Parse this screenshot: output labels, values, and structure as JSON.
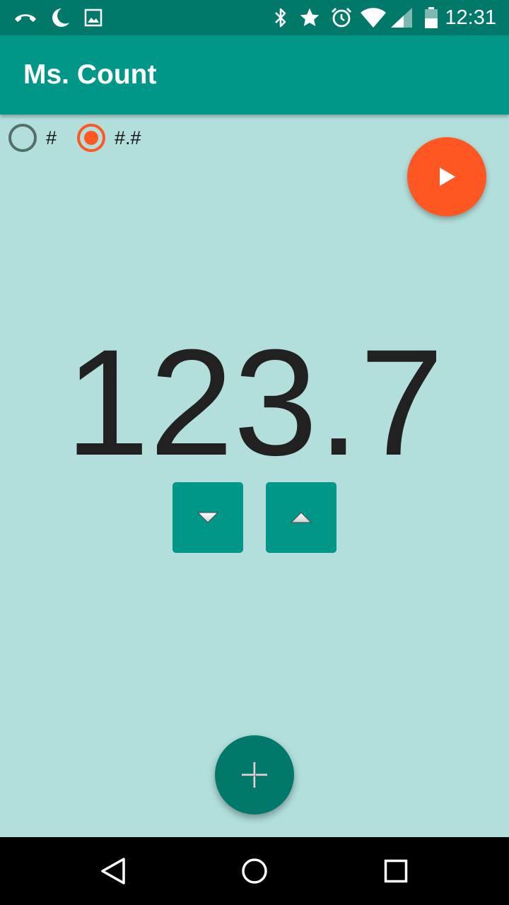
{
  "status_bar": {
    "time": "12:31",
    "icons_left": [
      "phone-hangup-icon",
      "do-not-disturb-moon-icon",
      "image-notification-icon"
    ],
    "icons_right": [
      "bluetooth-icon",
      "star-icon",
      "alarm-icon",
      "wifi-icon",
      "signal-icon",
      "battery-icon"
    ],
    "background": "#00796b"
  },
  "app_bar": {
    "title": "Ms. Count",
    "background": "#009688"
  },
  "format_options": {
    "integer_label": "#",
    "decimal_label": "#.#",
    "selected": "#.#"
  },
  "counter": {
    "value": "123.7"
  },
  "controls": {
    "play_icon": "play-icon",
    "decrement_icon": "triangle-down-icon",
    "increment_icon": "triangle-up-icon",
    "add_icon": "plus-icon"
  },
  "nav_bar": {
    "icons": [
      "back-icon",
      "home-icon",
      "recents-icon"
    ]
  },
  "colors": {
    "screen_background": "#b2dfdb",
    "accent": "#ff5722",
    "primary": "#009688",
    "primary_dark": "#00796b"
  }
}
